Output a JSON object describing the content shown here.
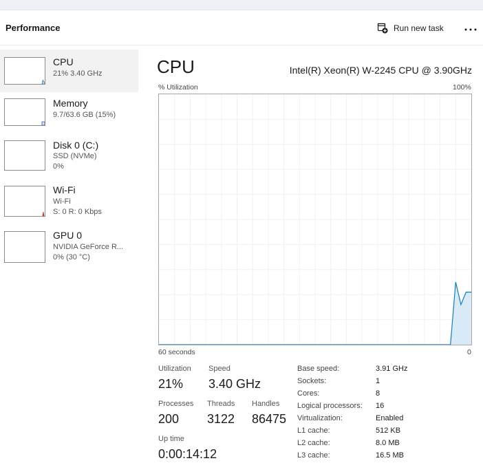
{
  "header": {
    "title": "Performance",
    "run_task_label": "Run new task",
    "more_icon": "ellipsis-icon"
  },
  "sidebar": {
    "items": [
      {
        "name": "CPU",
        "line1": "21%  3.40 GHz",
        "line2": "",
        "color": "#1a7fbf",
        "usage": 0.21
      },
      {
        "name": "Memory",
        "line1": "9.7/63.6 GB (15%)",
        "line2": "",
        "color": "#8b3fd1",
        "usage": 0.15
      },
      {
        "name": "Disk 0 (C:)",
        "line1": "SSD (NVMe)",
        "line2": "0%",
        "color": "#4aa83f",
        "usage": 0.0
      },
      {
        "name": "Wi-Fi",
        "line1": "Wi-Fi",
        "line2": "S: 0  R: 0 Kbps",
        "color": "#c0392b",
        "usage": 0.0
      },
      {
        "name": "GPU 0",
        "line1": "NVIDIA GeForce R...",
        "line2": "0%  (30 °C)",
        "color": "#1a7fbf",
        "usage": 0.0
      }
    ]
  },
  "main": {
    "title": "CPU",
    "model": "Intel(R) Xeon(R) W-2245 CPU @ 3.90GHz",
    "utilization_axis_label": "% Utilization",
    "max_label": "100%",
    "time_label": "60 seconds",
    "min_label": "0"
  },
  "chart_data": {
    "type": "area",
    "title": "",
    "xlabel": "60 seconds",
    "ylabel": "% Utilization",
    "xlim": [
      60,
      0
    ],
    "ylim": [
      0,
      100
    ],
    "grid": true,
    "series": [
      {
        "values_seconds_ago": [
          60,
          59,
          58,
          57,
          56,
          55,
          54,
          53,
          52,
          51,
          50,
          49,
          48,
          47,
          46,
          45,
          44,
          43,
          42,
          41,
          40,
          39,
          38,
          37,
          36,
          35,
          34,
          33,
          32,
          31,
          30,
          29,
          28,
          27,
          26,
          25,
          24,
          23,
          22,
          21,
          20,
          19,
          18,
          17,
          16,
          15,
          14,
          13,
          12,
          11,
          10,
          9,
          8,
          7,
          6,
          5,
          4,
          3,
          2,
          1,
          0
        ],
        "values": [
          0,
          0,
          0,
          0,
          0,
          0,
          0,
          0,
          0,
          0,
          0,
          0,
          0,
          0,
          0,
          0,
          0,
          0,
          0,
          0,
          0,
          0,
          0,
          0,
          0,
          0,
          0,
          0,
          0,
          0,
          0,
          0,
          0,
          0,
          0,
          0,
          0,
          0,
          0,
          0,
          0,
          0,
          0,
          0,
          0,
          0,
          0,
          0,
          0,
          0,
          0,
          0,
          0,
          0,
          0,
          0,
          0,
          25,
          16,
          21,
          21
        ],
        "color": "#117dbb",
        "fill": "#d7eaf6"
      }
    ]
  },
  "stats": {
    "utilization": {
      "label": "Utilization",
      "value": "21%"
    },
    "speed": {
      "label": "Speed",
      "value": "3.40 GHz"
    },
    "processes": {
      "label": "Processes",
      "value": "200"
    },
    "threads": {
      "label": "Threads",
      "value": "3122"
    },
    "handles": {
      "label": "Handles",
      "value": "86475"
    },
    "uptime": {
      "label": "Up time",
      "value": "0:00:14:12"
    }
  },
  "specs": [
    {
      "label": "Base speed:",
      "value": "3.91 GHz"
    },
    {
      "label": "Sockets:",
      "value": "1"
    },
    {
      "label": "Cores:",
      "value": "8"
    },
    {
      "label": "Logical processors:",
      "value": "16"
    },
    {
      "label": "Virtualization:",
      "value": "Enabled"
    },
    {
      "label": "L1 cache:",
      "value": "512 KB"
    },
    {
      "label": "L2 cache:",
      "value": "8.0 MB"
    },
    {
      "label": "L3 cache:",
      "value": "16.5 MB"
    }
  ]
}
